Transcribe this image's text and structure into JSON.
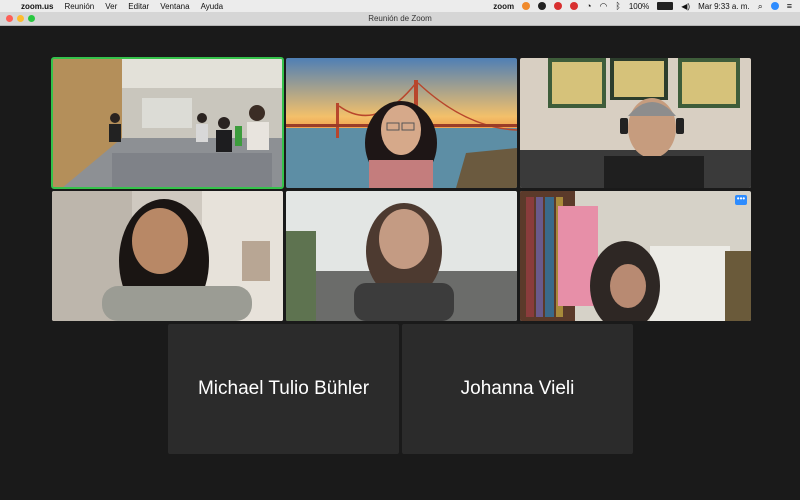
{
  "menubar": {
    "apple": "",
    "app": "zoom.us",
    "items": [
      "Reunión",
      "Ver",
      "Editar",
      "Ventana",
      "Ayuda"
    ],
    "zoom_status": "zoom",
    "battery": "100%",
    "clock": "Mar 9:33 a. m."
  },
  "window": {
    "title": "Reunión de Zoom"
  },
  "participants": {
    "p1": {
      "desc": "conference-room"
    },
    "p2": {
      "desc": "golden-gate-background"
    },
    "p3": {
      "desc": "man-with-headset"
    },
    "p4": {
      "desc": "woman-smiling"
    },
    "p5": {
      "desc": "woman-glasses-window"
    },
    "p6": {
      "desc": "woman-bookshelf"
    },
    "p7": {
      "name": "Michael Tulio Bühler"
    },
    "p8": {
      "name": "Johanna Vieli"
    }
  },
  "more_label": "•••",
  "colors": {
    "active": "#35c24b",
    "accent": "#2d8cff",
    "tile": "#2b2b2b",
    "bg": "#1a1a1a"
  }
}
